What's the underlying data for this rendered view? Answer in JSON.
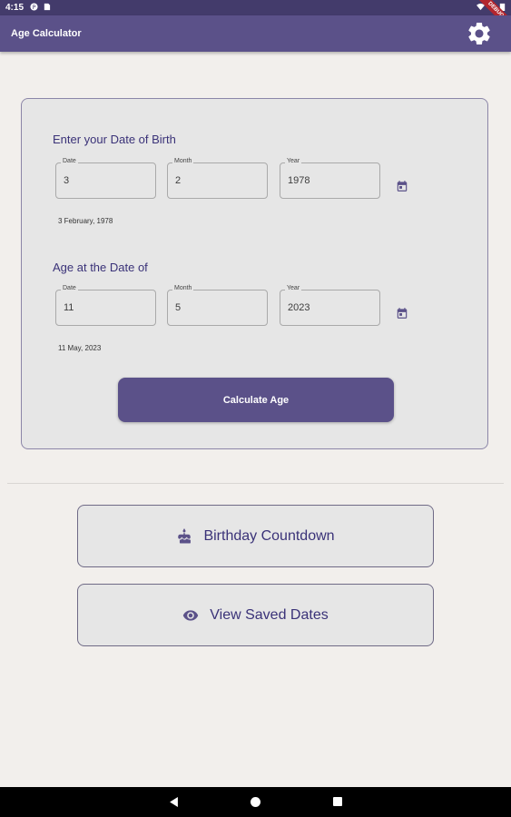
{
  "status_bar": {
    "time": "4:15"
  },
  "debug_banner": "DEBUG",
  "app_bar": {
    "title": "Age Calculator",
    "settings_icon": "gear-icon"
  },
  "birth": {
    "title": "Enter your Date of Birth",
    "date_label": "Date",
    "date_value": "3",
    "month_label": "Month",
    "month_value": "2",
    "year_label": "Year",
    "year_value": "1978",
    "formatted": "3 February, 1978",
    "calendar_icon": "calendar-icon"
  },
  "target": {
    "title": "Age at the Date of",
    "date_label": "Date",
    "date_value": "11",
    "month_label": "Month",
    "month_value": "5",
    "year_label": "Year",
    "year_value": "2023",
    "formatted": "11 May, 2023",
    "calendar_icon": "calendar-icon"
  },
  "calculate_label": "Calculate Age",
  "actions": {
    "countdown_label": "Birthday Countdown",
    "countdown_icon": "cake-icon",
    "saved_label": "View Saved Dates",
    "saved_icon": "eye-icon"
  },
  "colors": {
    "primary": "#5b5189",
    "accent_text": "#3a3278",
    "background": "#f2efec"
  }
}
